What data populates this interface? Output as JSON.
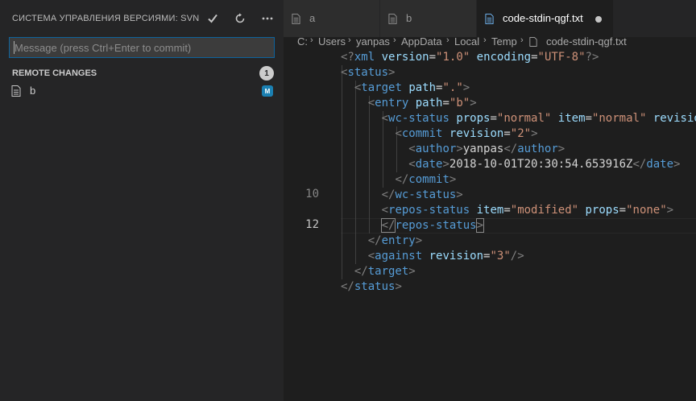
{
  "sidebar": {
    "title": "СИСТЕМА УПРАВЛЕНИЯ ВЕРСИЯМИ: SVN",
    "commit_placeholder": "Message (press Ctrl+Enter to commit)",
    "section": {
      "label": "REMOTE CHANGES",
      "count": "1"
    },
    "changes": [
      {
        "name": "b",
        "status": "M"
      }
    ],
    "actions": [
      "commit-check-icon",
      "refresh-icon",
      "more-icon"
    ]
  },
  "tabs": [
    {
      "label": "a",
      "active": false
    },
    {
      "label": "b",
      "active": false
    },
    {
      "label": "code-stdin-qgf.txt",
      "active": true,
      "dirty": true
    }
  ],
  "breadcrumb": [
    "C:",
    "Users",
    "yanpas",
    "AppData",
    "Local",
    "Temp",
    "code-stdin-qgf.txt"
  ],
  "editor": {
    "line_numbers": [
      {
        "n": "10",
        "active": false
      },
      {
        "n": "12",
        "active": true
      }
    ],
    "lines": [
      [
        [
          "p",
          "<?"
        ],
        [
          "t",
          "xml"
        ],
        [
          "x",
          " "
        ],
        [
          "a",
          "version"
        ],
        [
          "x",
          "="
        ],
        [
          "v",
          "\"1.0\""
        ],
        [
          "x",
          " "
        ],
        [
          "a",
          "encoding"
        ],
        [
          "x",
          "="
        ],
        [
          "v",
          "\"UTF-8\""
        ],
        [
          "p",
          "?>"
        ]
      ],
      [
        [
          "p",
          "<"
        ],
        [
          "t",
          "status"
        ],
        [
          "p",
          ">"
        ]
      ],
      [
        [
          "x",
          "  "
        ],
        [
          "p",
          "<"
        ],
        [
          "t",
          "target"
        ],
        [
          "x",
          " "
        ],
        [
          "a",
          "path"
        ],
        [
          "x",
          "="
        ],
        [
          "v",
          "\".\""
        ],
        [
          "p",
          ">"
        ]
      ],
      [
        [
          "x",
          "    "
        ],
        [
          "p",
          "<"
        ],
        [
          "t",
          "entry"
        ],
        [
          "x",
          " "
        ],
        [
          "a",
          "path"
        ],
        [
          "x",
          "="
        ],
        [
          "v",
          "\"b\""
        ],
        [
          "p",
          ">"
        ]
      ],
      [
        [
          "x",
          "      "
        ],
        [
          "p",
          "<"
        ],
        [
          "t",
          "wc-status"
        ],
        [
          "x",
          " "
        ],
        [
          "a",
          "props"
        ],
        [
          "x",
          "="
        ],
        [
          "v",
          "\"normal\""
        ],
        [
          "x",
          " "
        ],
        [
          "a",
          "item"
        ],
        [
          "x",
          "="
        ],
        [
          "v",
          "\"normal\""
        ],
        [
          "x",
          " "
        ],
        [
          "a",
          "revision"
        ]
      ],
      [
        [
          "x",
          "        "
        ],
        [
          "p",
          "<"
        ],
        [
          "t",
          "commit"
        ],
        [
          "x",
          " "
        ],
        [
          "a",
          "revision"
        ],
        [
          "x",
          "="
        ],
        [
          "v",
          "\"2\""
        ],
        [
          "p",
          ">"
        ]
      ],
      [
        [
          "x",
          "          "
        ],
        [
          "p",
          "<"
        ],
        [
          "t",
          "author"
        ],
        [
          "p",
          ">"
        ],
        [
          "x",
          "yanpas"
        ],
        [
          "p",
          "</"
        ],
        [
          "t",
          "author"
        ],
        [
          "p",
          ">"
        ]
      ],
      [
        [
          "x",
          "          "
        ],
        [
          "p",
          "<"
        ],
        [
          "t",
          "date"
        ],
        [
          "p",
          ">"
        ],
        [
          "x",
          "2018-10-01T20:30:54.653916Z"
        ],
        [
          "p",
          "</"
        ],
        [
          "t",
          "date"
        ],
        [
          "p",
          ">"
        ]
      ],
      [
        [
          "x",
          "        "
        ],
        [
          "p",
          "</"
        ],
        [
          "t",
          "commit"
        ],
        [
          "p",
          ">"
        ]
      ],
      [
        [
          "x",
          "      "
        ],
        [
          "p",
          "</"
        ],
        [
          "t",
          "wc-status"
        ],
        [
          "p",
          ">"
        ]
      ],
      [
        [
          "x",
          "      "
        ],
        [
          "p",
          "<"
        ],
        [
          "t",
          "repos-status"
        ],
        [
          "x",
          " "
        ],
        [
          "a",
          "item"
        ],
        [
          "x",
          "="
        ],
        [
          "v",
          "\"modified\""
        ],
        [
          "x",
          " "
        ],
        [
          "a",
          "props"
        ],
        [
          "x",
          "="
        ],
        [
          "v",
          "\"none\""
        ],
        [
          "p",
          ">"
        ]
      ],
      [
        [
          "x",
          "      "
        ],
        [
          "p",
          "</"
        ],
        [
          "t",
          "repos-status"
        ],
        [
          "p",
          ">"
        ]
      ],
      [
        [
          "x",
          "    "
        ],
        [
          "p",
          "</"
        ],
        [
          "t",
          "entry"
        ],
        [
          "p",
          ">"
        ]
      ],
      [
        [
          "x",
          "    "
        ],
        [
          "p",
          "<"
        ],
        [
          "t",
          "against"
        ],
        [
          "x",
          " "
        ],
        [
          "a",
          "revision"
        ],
        [
          "x",
          "="
        ],
        [
          "v",
          "\"3\""
        ],
        [
          "p",
          "/>"
        ]
      ],
      [
        [
          "x",
          "  "
        ],
        [
          "p",
          "</"
        ],
        [
          "t",
          "target"
        ],
        [
          "p",
          ">"
        ]
      ],
      [
        [
          "p",
          "</"
        ],
        [
          "t",
          "status"
        ],
        [
          "p",
          ">"
        ]
      ]
    ]
  },
  "colors": {
    "accent": "#0e639c",
    "tag": "#569cd6",
    "attr": "#9cdcfe",
    "string": "#ce9178",
    "punct": "#808080",
    "badge_modified": "#1b80b2"
  }
}
